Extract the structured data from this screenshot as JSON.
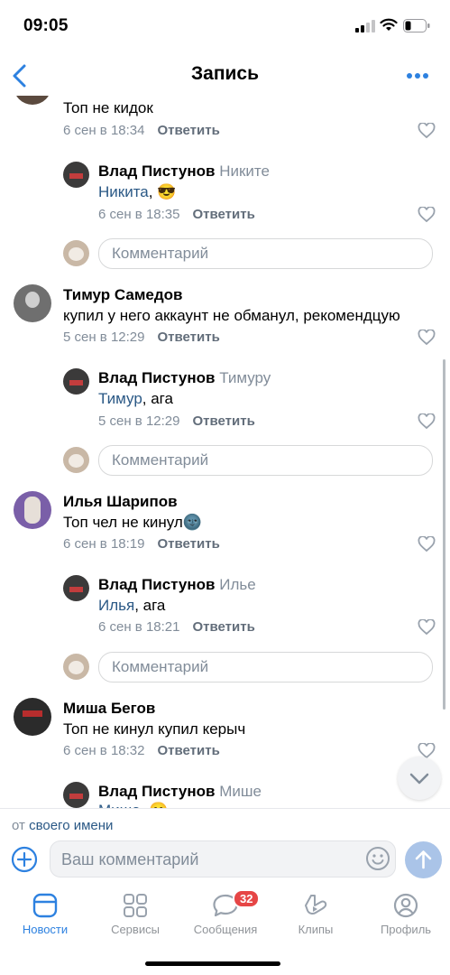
{
  "status": {
    "time": "09:05"
  },
  "header": {
    "title": "Запись"
  },
  "thread": [
    {
      "text": "Топ не кидок",
      "time": "6 сен в 18:34",
      "reply": "Ответить"
    },
    {
      "author": "Влад Пистунов",
      "to": "Никите",
      "mention": "Никита",
      "rest": ", ",
      "emoji": "😎",
      "time": "6 сен в 18:35",
      "reply": "Ответить"
    },
    {
      "comment_placeholder": "Комментарий"
    },
    {
      "author": "Тимур Самедов",
      "text": "купил у него аккаунт не обманул, рекомендцую",
      "time": "5 сен в 12:29",
      "reply": "Ответить"
    },
    {
      "author": "Влад Пистунов",
      "to": "Тимуру",
      "mention": "Тимур",
      "rest": ", ага",
      "time": "5 сен в 12:29",
      "reply": "Ответить"
    },
    {
      "comment_placeholder": "Комментарий"
    },
    {
      "author": "Илья Шарипов",
      "text": "Топ чел не кинул",
      "emoji": "🌚",
      "time": "6 сен в 18:19",
      "reply": "Ответить"
    },
    {
      "author": "Влад Пистунов",
      "to": "Илье",
      "mention": "Илья",
      "rest": ", ага",
      "time": "6 сен в 18:21",
      "reply": "Ответить"
    },
    {
      "comment_placeholder": "Комментарий"
    },
    {
      "author": "Миша Бегов",
      "text": "Топ не кинул купил керыч",
      "time": "6 сен в 18:32",
      "reply": "Ответить"
    },
    {
      "author": "Влад Пистунов",
      "to": "Мише",
      "mention": "Миша",
      "rest": ", ",
      "emoji": "😊"
    }
  ],
  "composer": {
    "from_prefix": "от",
    "from_link": "своего имени",
    "placeholder": "Ваш комментарий"
  },
  "tabbar": [
    {
      "label": "Новости",
      "icon": "news-icon"
    },
    {
      "label": "Сервисы",
      "icon": "services-icon"
    },
    {
      "label": "Сообщения",
      "icon": "messages-icon",
      "badge": "32"
    },
    {
      "label": "Клипы",
      "icon": "clips-icon"
    },
    {
      "label": "Профиль",
      "icon": "profile-icon"
    }
  ],
  "colors": {
    "accent": "#2d81e0",
    "link": "#2a5885",
    "secondary": "#818c99",
    "badge": "#e64646"
  }
}
